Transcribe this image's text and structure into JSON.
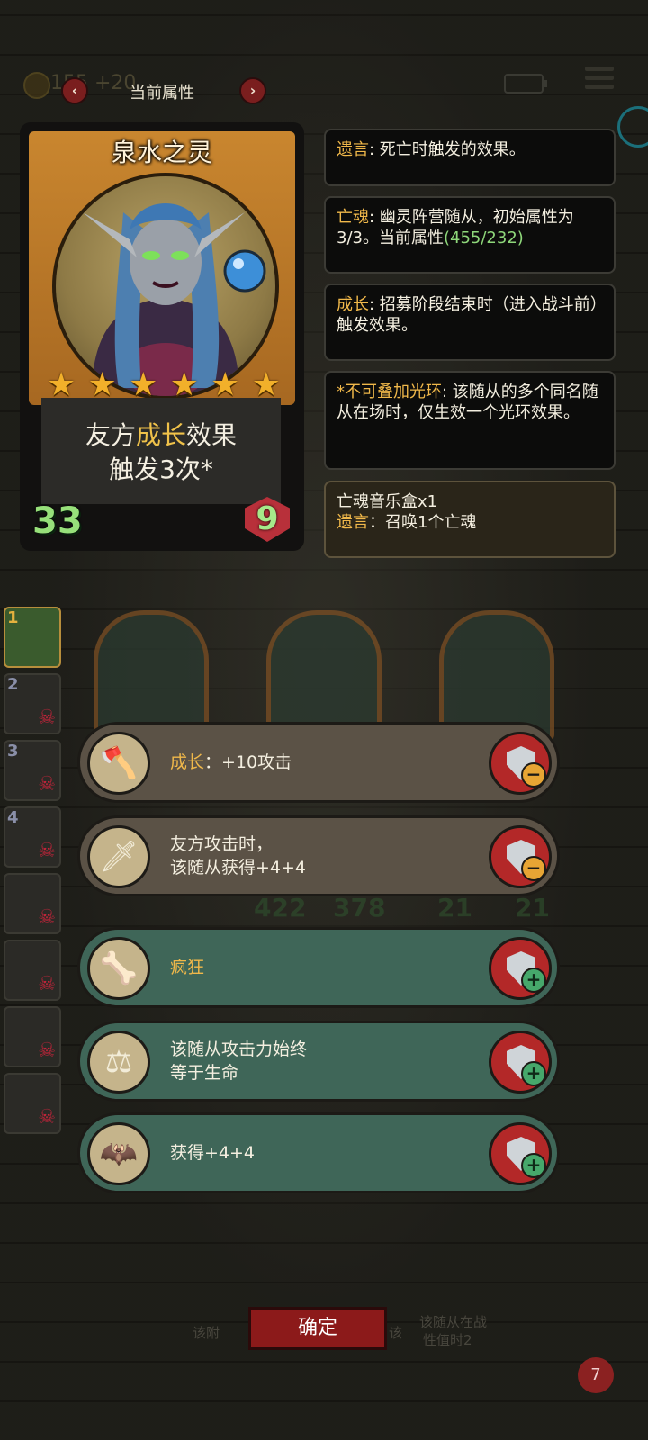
{
  "top_bar": {
    "coin_text": "155 +20",
    "title": "当前属性",
    "prev_icon": "chevron-left-icon",
    "next_icon": "chevron-right-icon"
  },
  "card": {
    "name": "泉水之灵",
    "stars": 6,
    "desc_prefix": "友方",
    "desc_highlight": "成长",
    "desc_suffix": "效果",
    "desc_line2": "触发3次*",
    "attack": "33",
    "health": "9"
  },
  "info": [
    {
      "key": "遗言",
      "text": ": 死亡时触发的效果。"
    },
    {
      "key": "亡魂",
      "text": ": 幽灵阵营随从，初始属性为3/3。当前属性",
      "value": "(455/232)"
    },
    {
      "key": "成长",
      "text": ": 招募阶段结束时（进入战斗前）触发效果。"
    },
    {
      "key": "*不可叠加光环",
      "text": ": 该随从的多个同名随从在场时，仅生效一个光环效果。"
    }
  ],
  "item": {
    "name": "亡魂音乐盒x1",
    "key": "遗言",
    "text": "：召唤1个亡魂"
  },
  "sidebar": {
    "slots": [
      "1",
      "2",
      "3",
      "4"
    ]
  },
  "board": {
    "stats": [
      "422",
      "378",
      "21",
      "21"
    ]
  },
  "abilities": [
    {
      "key": "成长",
      "text": "：+10攻击",
      "state": "equipped",
      "icon": "axe-icon"
    },
    {
      "line1": "友方攻击时，",
      "line2": "该随从获得+4+4",
      "state": "equipped",
      "icon": "curved-blade-icon"
    },
    {
      "key": "疯狂",
      "state": "available",
      "icon": "horn-icon"
    },
    {
      "line1": "该随从攻击力始终",
      "line2": "等于生命",
      "state": "available",
      "icon": "scales-icon"
    },
    {
      "text": "获得+4+4",
      "state": "available",
      "icon": "bat-wing-icon"
    }
  ],
  "bottom": {
    "confirm": "确定",
    "hand_label_1": "该附",
    "hand_label_2": "该",
    "hand_label_3": "该随从在战",
    "hand_label_4": "性值时2",
    "lives": "7"
  },
  "colors": {
    "accent_gold": "#f0b84a",
    "value_green": "#8ed77a",
    "equipped_row": "#5b5246",
    "available_row": "#3f6658",
    "button_red": "#b32828"
  }
}
